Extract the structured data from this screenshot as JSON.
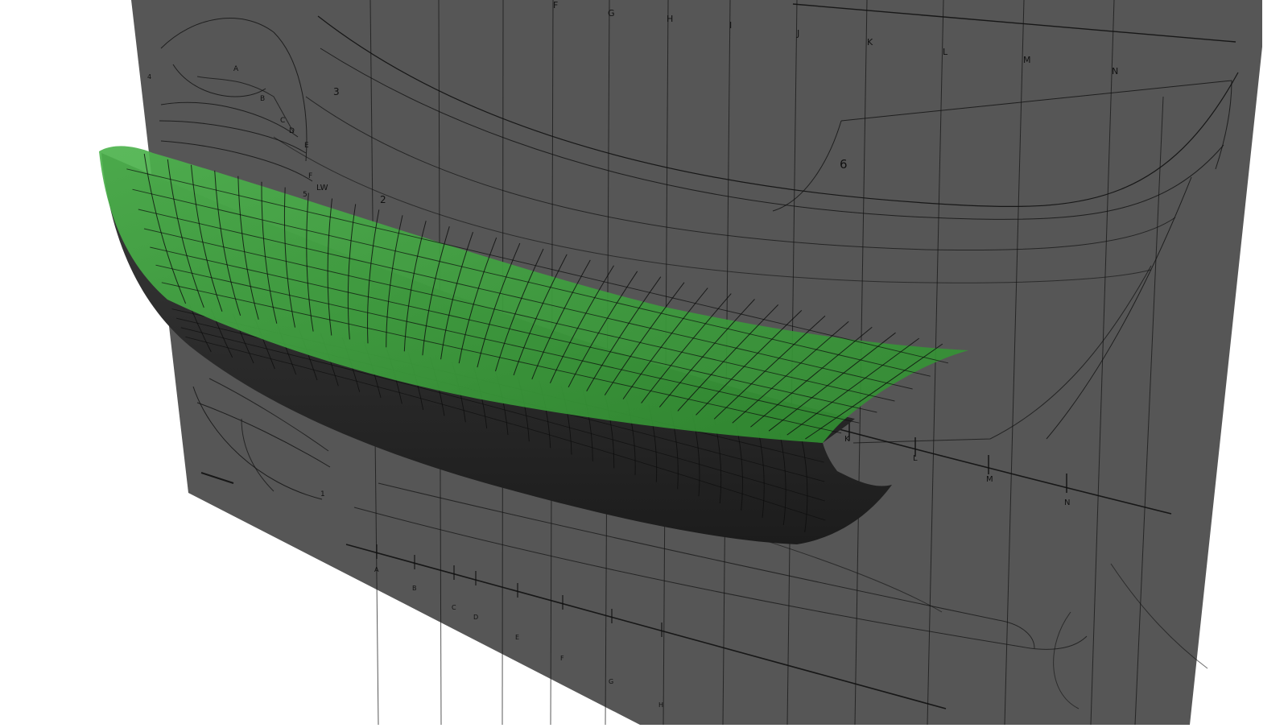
{
  "viewport": {
    "background": "#ffffff"
  },
  "backdrop": {
    "panel_color": "#565656",
    "line_color": "#111111",
    "station_labels_top": [
      "F",
      "G",
      "H",
      "I",
      "J",
      "K",
      "L",
      "M",
      "N"
    ],
    "station_labels_bottom": [
      "A",
      "B",
      "C",
      "D",
      "E",
      "F",
      "G",
      "H"
    ],
    "station_labels_mid": [
      "K",
      "L",
      "M",
      "N"
    ],
    "body_plan_labels": [
      "A",
      "B",
      "C",
      "D",
      "E",
      "F"
    ],
    "waterline_label": "LW",
    "numeric_labels": [
      "1",
      "2",
      "3",
      "4",
      "5",
      "6"
    ]
  },
  "hull": {
    "topside_color": "#4db34d",
    "bottom_color": "#1c1c1c",
    "mesh_line_color": "#0b0b0b"
  }
}
